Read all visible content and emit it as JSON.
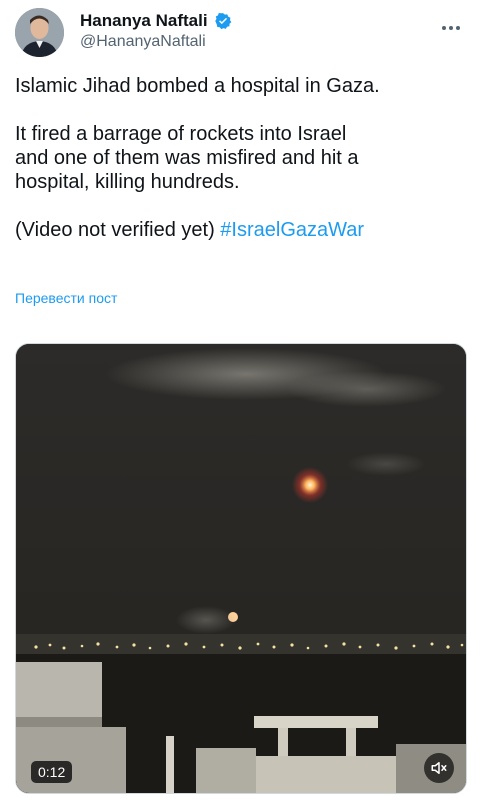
{
  "tweet": {
    "author_name": "Hananya Naftali",
    "author_handle": "@HananyaNaftali",
    "paragraphs": [
      "Islamic Jihad bombed a hospital in Gaza.",
      "It fired a barrage of rockets into Israel\nand one of them was misfired and hit a\nhospital, killing hundreds."
    ],
    "last_line_prefix": "(Video not verified yet) ",
    "hashtag": "#IsraelGazaWar",
    "translate_label": "Перевести пост"
  },
  "video": {
    "duration": "0:12",
    "icon": "mute-icon"
  },
  "colors": {
    "text": "#0f1419",
    "secondary": "#536471",
    "link": "#1d9bf0"
  }
}
